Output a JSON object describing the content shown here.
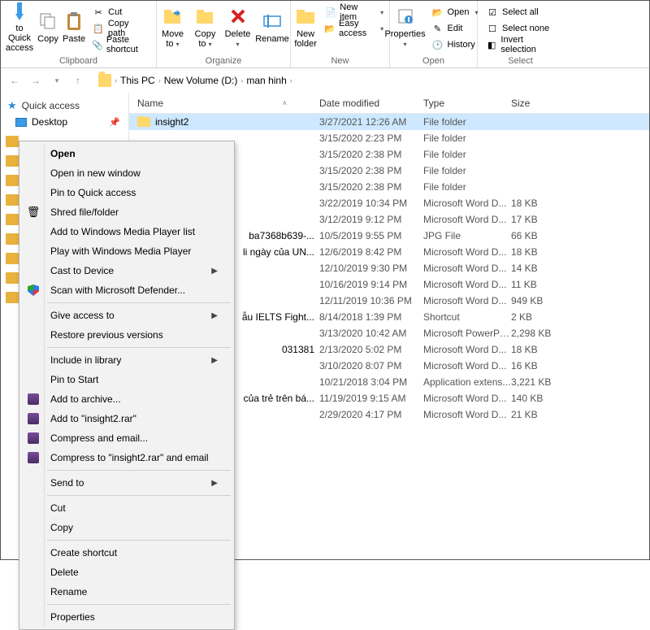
{
  "ribbon": {
    "pin_quick": "to Quick access",
    "copy": "Copy",
    "paste": "Paste",
    "cut": "Cut",
    "copy_path": "Copy path",
    "paste_shortcut": "Paste shortcut",
    "clipboard_group": "Clipboard",
    "move_to": "Move to",
    "copy_to": "Copy to",
    "delete": "Delete",
    "rename": "Rename",
    "organize_group": "Organize",
    "new_folder": "New folder",
    "new_item": "New item",
    "easy_access": "Easy access",
    "new_group": "New",
    "properties": "Properties",
    "open": "Open",
    "edit": "Edit",
    "history": "History",
    "open_group": "Open",
    "select_all": "Select all",
    "select_none": "Select none",
    "invert": "Invert selection",
    "select_group": "Select"
  },
  "breadcrumb": {
    "this_pc": "This PC",
    "volume": "New Volume (D:)",
    "folder": "man hinh"
  },
  "sidebar": {
    "quick_access": "Quick access",
    "desktop": "Desktop"
  },
  "columns": {
    "name": "Name",
    "date": "Date modified",
    "type": "Type",
    "size": "Size"
  },
  "rows": [
    {
      "name": "insight2",
      "date": "3/27/2021 12:26 AM",
      "type": "File folder",
      "size": "",
      "selected": true,
      "show_name": true
    },
    {
      "name": "",
      "date": "3/15/2020 2:23 PM",
      "type": "File folder",
      "size": ""
    },
    {
      "name": "",
      "date": "3/15/2020 2:38 PM",
      "type": "File folder",
      "size": ""
    },
    {
      "name": "",
      "date": "3/15/2020 2:38 PM",
      "type": "File folder",
      "size": ""
    },
    {
      "name": "",
      "date": "3/15/2020 2:38 PM",
      "type": "File folder",
      "size": ""
    },
    {
      "name": "",
      "date": "3/22/2019 10:34 PM",
      "type": "Microsoft Word D...",
      "size": "18 KB"
    },
    {
      "name": "",
      "date": "3/12/2019 9:12 PM",
      "type": "Microsoft Word D...",
      "size": "17 KB"
    },
    {
      "name": "ba7368b639-...",
      "date": "10/5/2019 9:55 PM",
      "type": "JPG File",
      "size": "66 KB"
    },
    {
      "name": "li ngày của UN...",
      "date": "12/6/2019 8:42 PM",
      "type": "Microsoft Word D...",
      "size": "18 KB"
    },
    {
      "name": "",
      "date": "12/10/2019 9:30 PM",
      "type": "Microsoft Word D...",
      "size": "14 KB"
    },
    {
      "name": "",
      "date": "10/16/2019 9:14 PM",
      "type": "Microsoft Word D...",
      "size": "11 KB"
    },
    {
      "name": "",
      "date": "12/11/2019 10:36 PM",
      "type": "Microsoft Word D...",
      "size": "949 KB"
    },
    {
      "name": "ẫu IELTS Fight...",
      "date": "8/14/2018 1:39 PM",
      "type": "Shortcut",
      "size": "2 KB"
    },
    {
      "name": "",
      "date": "3/13/2020 10:42 AM",
      "type": "Microsoft PowerPo...",
      "size": "2,298 KB"
    },
    {
      "name": "031381",
      "date": "2/13/2020 5:02 PM",
      "type": "Microsoft Word D...",
      "size": "18 KB"
    },
    {
      "name": "",
      "date": "3/10/2020 8:07 PM",
      "type": "Microsoft Word D...",
      "size": "16 KB"
    },
    {
      "name": "",
      "date": "10/21/2018 3:04 PM",
      "type": "Application extens...",
      "size": "3,221 KB"
    },
    {
      "name": "của trẻ trên bá...",
      "date": "11/19/2019 9:15 AM",
      "type": "Microsoft Word D...",
      "size": "140 KB"
    },
    {
      "name": "",
      "date": "2/29/2020 4:17 PM",
      "type": "Microsoft Word D...",
      "size": "21 KB"
    }
  ],
  "context_menu": [
    {
      "kind": "item",
      "label": "Open",
      "bold": true
    },
    {
      "kind": "item",
      "label": "Open in new window"
    },
    {
      "kind": "item",
      "label": "Pin to Quick access"
    },
    {
      "kind": "item",
      "label": "Shred file/folder",
      "icon": "shred"
    },
    {
      "kind": "item",
      "label": "Add to Windows Media Player list"
    },
    {
      "kind": "item",
      "label": "Play with Windows Media Player"
    },
    {
      "kind": "item",
      "label": "Cast to Device",
      "submenu": true
    },
    {
      "kind": "item",
      "label": "Scan with Microsoft Defender...",
      "icon": "defender"
    },
    {
      "kind": "sep"
    },
    {
      "kind": "item",
      "label": "Give access to",
      "submenu": true
    },
    {
      "kind": "item",
      "label": "Restore previous versions"
    },
    {
      "kind": "sep"
    },
    {
      "kind": "item",
      "label": "Include in library",
      "submenu": true
    },
    {
      "kind": "item",
      "label": "Pin to Start"
    },
    {
      "kind": "item",
      "label": "Add to archive...",
      "icon": "rar"
    },
    {
      "kind": "item",
      "label": "Add to \"insight2.rar\"",
      "icon": "rar"
    },
    {
      "kind": "item",
      "label": "Compress and email...",
      "icon": "rar"
    },
    {
      "kind": "item",
      "label": "Compress to \"insight2.rar\" and email",
      "icon": "rar"
    },
    {
      "kind": "sep"
    },
    {
      "kind": "item",
      "label": "Send to",
      "submenu": true
    },
    {
      "kind": "sep"
    },
    {
      "kind": "item",
      "label": "Cut"
    },
    {
      "kind": "item",
      "label": "Copy"
    },
    {
      "kind": "sep"
    },
    {
      "kind": "item",
      "label": "Create shortcut"
    },
    {
      "kind": "item",
      "label": "Delete"
    },
    {
      "kind": "item",
      "label": "Rename"
    },
    {
      "kind": "sep"
    },
    {
      "kind": "item",
      "label": "Properties"
    }
  ]
}
